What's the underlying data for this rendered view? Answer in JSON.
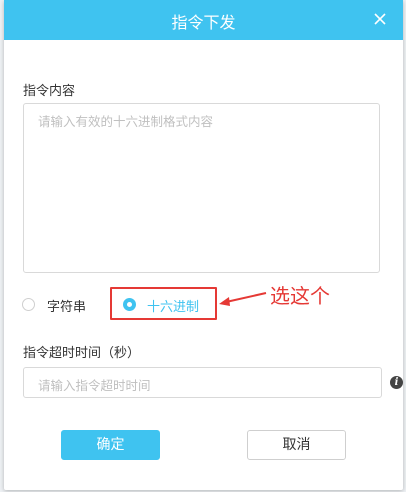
{
  "dialog": {
    "title": "指令下发",
    "content_label": "指令内容",
    "content_placeholder": "请输入有效的十六进制格式内容",
    "format_options": [
      {
        "label": "字符串",
        "selected": false
      },
      {
        "label": "十六进制",
        "selected": true
      }
    ],
    "timeout_label": "指令超时时间（秒）",
    "timeout_placeholder": "请输入指令超时时间",
    "confirm_label": "确定",
    "cancel_label": "取消"
  },
  "annotation": {
    "text": "选这个",
    "color": "#e53935"
  },
  "colors": {
    "accent": "#3fc3f0",
    "annotation": "#e53935"
  },
  "icons": {
    "close": "close-icon",
    "info": "info-icon"
  }
}
